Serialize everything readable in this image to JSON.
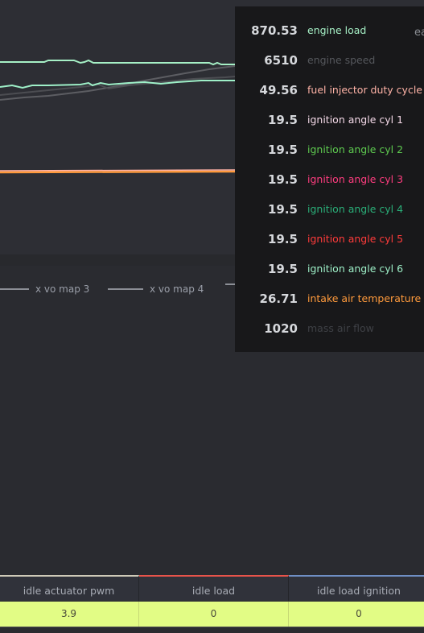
{
  "legend": {
    "items": [
      {
        "label": "x vo map 3"
      },
      {
        "label": "x vo map 4"
      }
    ]
  },
  "tooltip": {
    "partial_label": "ea",
    "rows": [
      {
        "value": "870.53",
        "label": "engine load",
        "color": "#a6f0c6"
      },
      {
        "value": "6510",
        "label": "engine speed",
        "color": "#55575c"
      },
      {
        "value": "49.56",
        "label": "fuel injector duty cycle",
        "color": "#ffb3a7"
      },
      {
        "value": "19.5",
        "label": "ignition angle cyl 1",
        "color": "#f4d9e8"
      },
      {
        "value": "19.5",
        "label": "ignition angle cyl 2",
        "color": "#5ecb50"
      },
      {
        "value": "19.5",
        "label": "ignition angle cyl 3",
        "color": "#ff3d7f"
      },
      {
        "value": "19.5",
        "label": "ignition angle cyl 4",
        "color": "#2aae78"
      },
      {
        "value": "19.5",
        "label": "ignition angle cyl 5",
        "color": "#ff3b3b"
      },
      {
        "value": "19.5",
        "label": "ignition angle cyl 6",
        "color": "#9ef0c8"
      },
      {
        "value": "26.71",
        "label": "intake air temperature",
        "color": "#ff9a3c"
      },
      {
        "value": "1020",
        "label": "mass air flow",
        "color": "#3e4045"
      }
    ]
  },
  "table": {
    "columns": [
      {
        "header": "idle actuator pwm",
        "value": "3.9",
        "accent": "#cfcab8"
      },
      {
        "header": "idle load",
        "value": "0",
        "accent": "#e8534a"
      },
      {
        "header": "idle load ignition",
        "value": "0",
        "accent": "#6f8fc4"
      }
    ]
  }
}
